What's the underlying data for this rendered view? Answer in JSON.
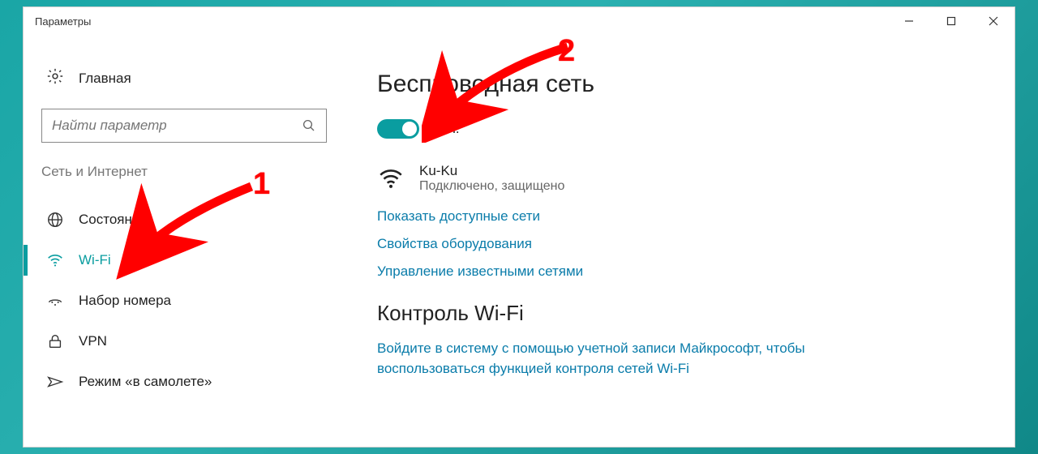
{
  "window": {
    "title": "Параметры"
  },
  "sidebar": {
    "home": "Главная",
    "search_placeholder": "Найти параметр",
    "category": "Сеть и Интернет",
    "items": [
      {
        "label": "Состояние"
      },
      {
        "label": "Wi-Fi"
      },
      {
        "label": "Набор номера"
      },
      {
        "label": "VPN"
      },
      {
        "label": "Режим «в самолете»"
      }
    ]
  },
  "content": {
    "heading": "Беспроводная сеть",
    "toggle_label": "Вкл.",
    "network": {
      "name": "Ku-Ku",
      "status": "Подключено, защищено"
    },
    "links": {
      "available": "Показать доступные сети",
      "hardware": "Свойства оборудования",
      "manage": "Управление известными сетями"
    },
    "section2": "Контроль Wi-Fi",
    "note": "Войдите в систему с помощью учетной записи Майкрософт, чтобы воспользоваться функцией контроля сетей Wi-Fi"
  },
  "annotations": {
    "one": "1",
    "two": "2"
  }
}
